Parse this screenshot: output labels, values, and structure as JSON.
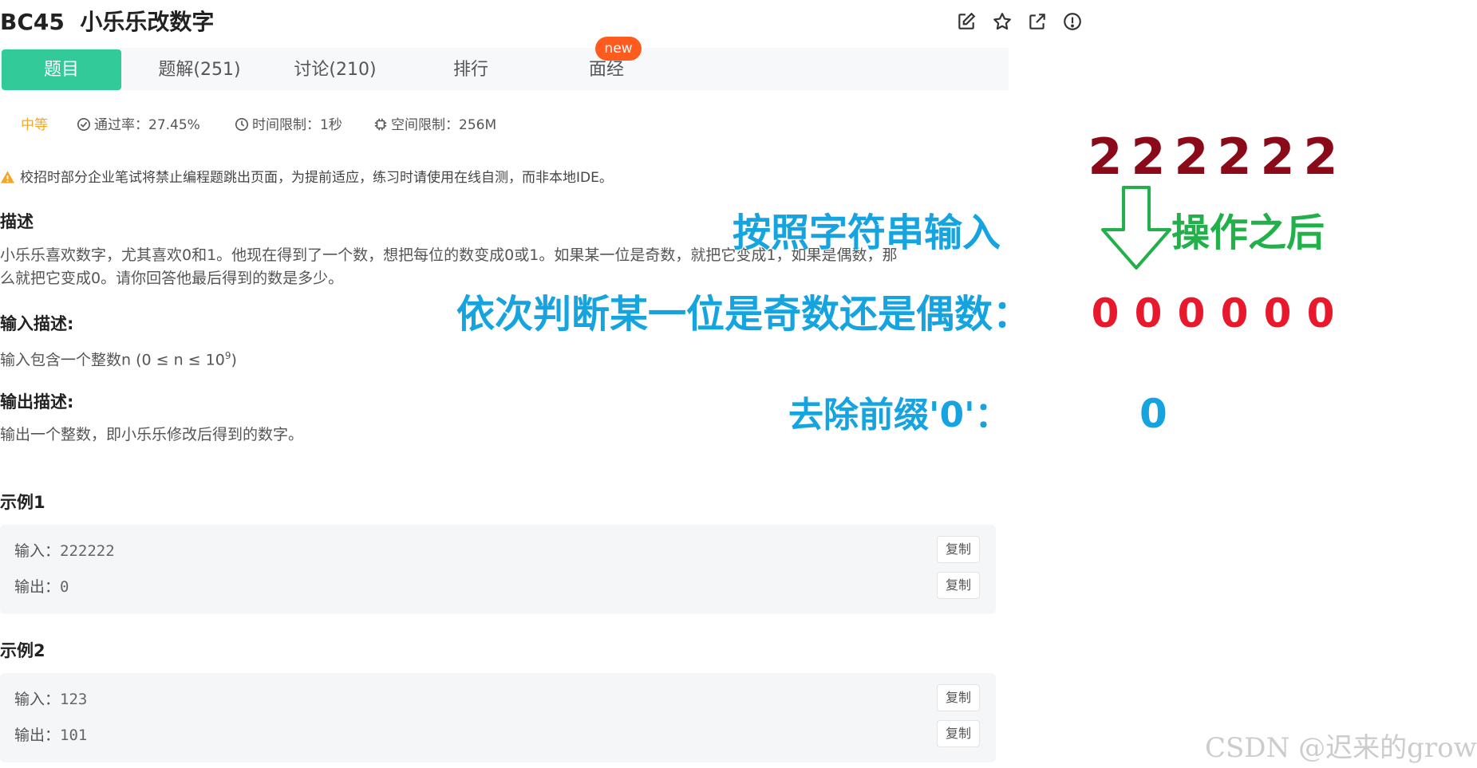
{
  "header": {
    "title": "BC45  小乐乐改数字",
    "icons": [
      "edit-icon",
      "star-icon",
      "share-icon",
      "info-icon"
    ]
  },
  "tabs": [
    {
      "label": "题目",
      "active": true
    },
    {
      "label": "题解(251)"
    },
    {
      "label": "讨论(210)"
    },
    {
      "label": "排行"
    },
    {
      "label": "面经",
      "badge": "new"
    }
  ],
  "meta": {
    "difficulty": "中等",
    "pass_rate": "通过率：27.45%",
    "time_limit": "时间限制：1秒",
    "space_limit": "空间限制：256M"
  },
  "warning": "校招时部分企业笔试将禁止编程题跳出页面，为提前适应，练习时请使用在线自测，而非本地IDE。",
  "description": {
    "heading": "描述",
    "text_line1": "小乐乐喜欢数字，尤其喜欢0和1。他现在得到了一个数，想把每位的数变成0或1。如果某一位是奇数，就把它变成1，如果是偶数，那",
    "text_line2": "么就把它变成0。请你回答他最后得到的数是多少。"
  },
  "input_desc": {
    "heading": "输入描述:",
    "text": "输入包含一个整数n (0 ≤ n ≤ 10",
    "sup": "9",
    "text_end": ")"
  },
  "output_desc": {
    "heading": "输出描述:",
    "text": "输出一个整数，即小乐乐修改后得到的数字。"
  },
  "examples": [
    {
      "heading": "示例1",
      "input_label": "输入：",
      "input": "222222",
      "output_label": "输出：",
      "output": "0",
      "copy": "复制"
    },
    {
      "heading": "示例2",
      "input_label": "输入：",
      "input": "123",
      "output_label": "输出：",
      "output": "101",
      "copy": "复制"
    }
  ],
  "annotations": {
    "label_input": "按照字符串输入",
    "label_judge": "依次判断某一位是奇数还是偶数：",
    "label_strip": "去除前缀'0'：",
    "label_after": "操作之后",
    "digits_input": [
      "2",
      "2",
      "2",
      "2",
      "2",
      "2"
    ],
    "digits_result": [
      "0",
      "0",
      "0",
      "0",
      "0",
      "0"
    ],
    "final": "0",
    "colors": {
      "blue": "#16a4e0",
      "dark_red": "#8b0a1a",
      "red": "#e8192c",
      "green": "#22b04b"
    }
  },
  "watermark": "CSDN @迟来的grown",
  "colors": {
    "tab_active": "#32ca99",
    "badge": "#ff5b1f",
    "difficulty": "#f5a623"
  }
}
